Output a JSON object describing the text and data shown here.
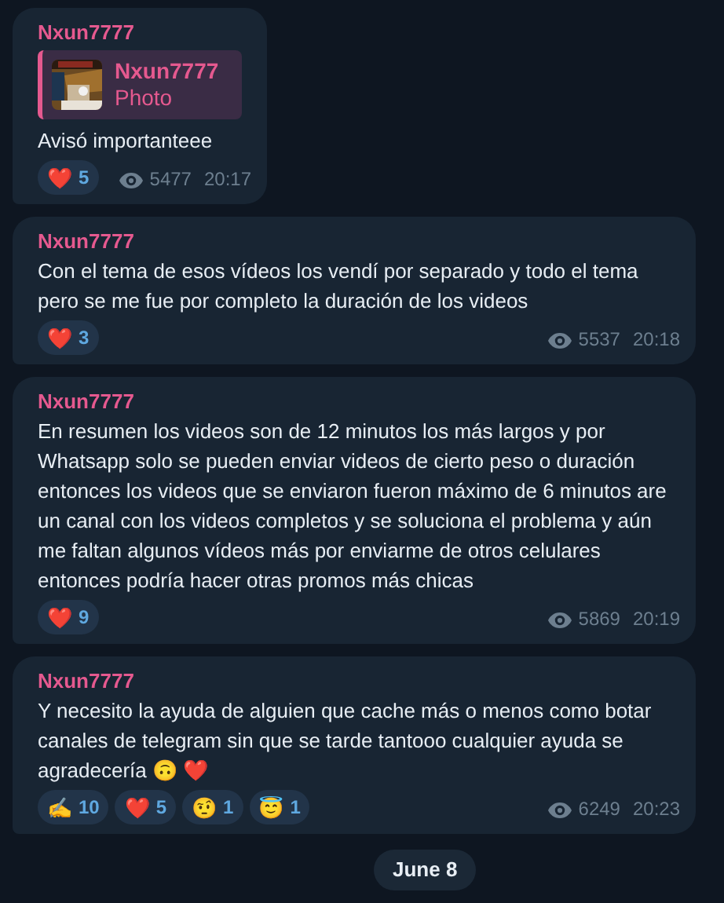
{
  "messages": [
    {
      "author": "Nxun7777",
      "reply": {
        "author": "Nxun7777",
        "label": "Photo"
      },
      "text": "Avisó importanteee",
      "reactions": [
        {
          "emoji": "❤️",
          "count": "5"
        }
      ],
      "views": "5477",
      "time": "20:17"
    },
    {
      "author": "Nxun7777",
      "text": "Con el tema de esos vídeos los vendí por separado y todo el tema pero se me fue por completo la duración de los videos",
      "reactions": [
        {
          "emoji": "❤️",
          "count": "3"
        }
      ],
      "views": "5537",
      "time": "20:18"
    },
    {
      "author": "Nxun7777",
      "text": "En resumen los videos son de 12 minutos los más largos y por Whatsapp solo se pueden enviar videos de cierto peso o duración entonces los videos que se enviaron fueron máximo de 6 minutos are un canal con los videos completos y se soluciona el problema y aún me faltan algunos vídeos más por enviarme de otros celulares entonces podría hacer otras promos más chicas",
      "reactions": [
        {
          "emoji": "❤️",
          "count": "9"
        }
      ],
      "views": "5869",
      "time": "20:19"
    },
    {
      "author": "Nxun7777",
      "text": "Y necesito la ayuda de alguien que cache más o menos como botar canales de telegram sin que se tarde tantooo cualquier ayuda se agradecería 🙃 ❤️",
      "reactions": [
        {
          "emoji": "✍️",
          "count": "10"
        },
        {
          "emoji": "❤️",
          "count": "5"
        },
        {
          "emoji": "🤨",
          "count": "1"
        },
        {
          "emoji": "😇",
          "count": "1"
        }
      ],
      "views": "6249",
      "time": "20:23"
    }
  ],
  "date_chip": "June 8"
}
